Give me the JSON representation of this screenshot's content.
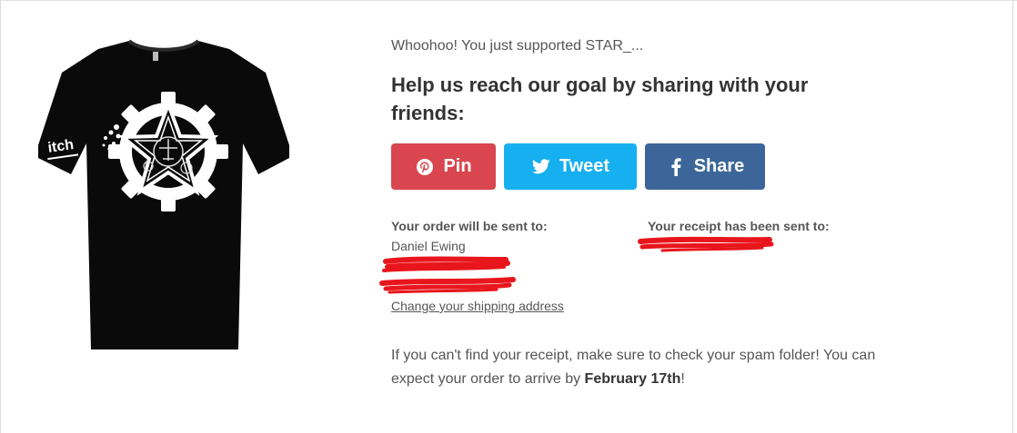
{
  "supported_text": "Whoohoo! You just supported STAR_...",
  "headline": "Help us reach our goal by sharing with your friends:",
  "share": {
    "pin": {
      "label": "Pin",
      "icon": "pinterest-icon",
      "color": "#d9464f"
    },
    "tweet": {
      "label": "Tweet",
      "icon": "twitter-bird-icon",
      "color": "#16aff0"
    },
    "share": {
      "label": "Share",
      "icon": "facebook-f-icon",
      "color": "#3c6699"
    }
  },
  "order": {
    "label": "Your order will be sent to:",
    "name": "Daniel Ewing"
  },
  "receipt": {
    "label": "Your receipt has been sent to:"
  },
  "change_shipping_link": "Change your shipping address",
  "note": {
    "text_before": "If you can't find your receipt, make sure to check your spam folder! You can expect your order to arrive by ",
    "date": "February 17th",
    "text_after": "!"
  },
  "product": {
    "icon": "tshirt-image",
    "sleeve_text": "itch",
    "shirt_color": "#0a0a0a",
    "print_color": "#ffffff"
  },
  "redaction_color": "#e8161c"
}
